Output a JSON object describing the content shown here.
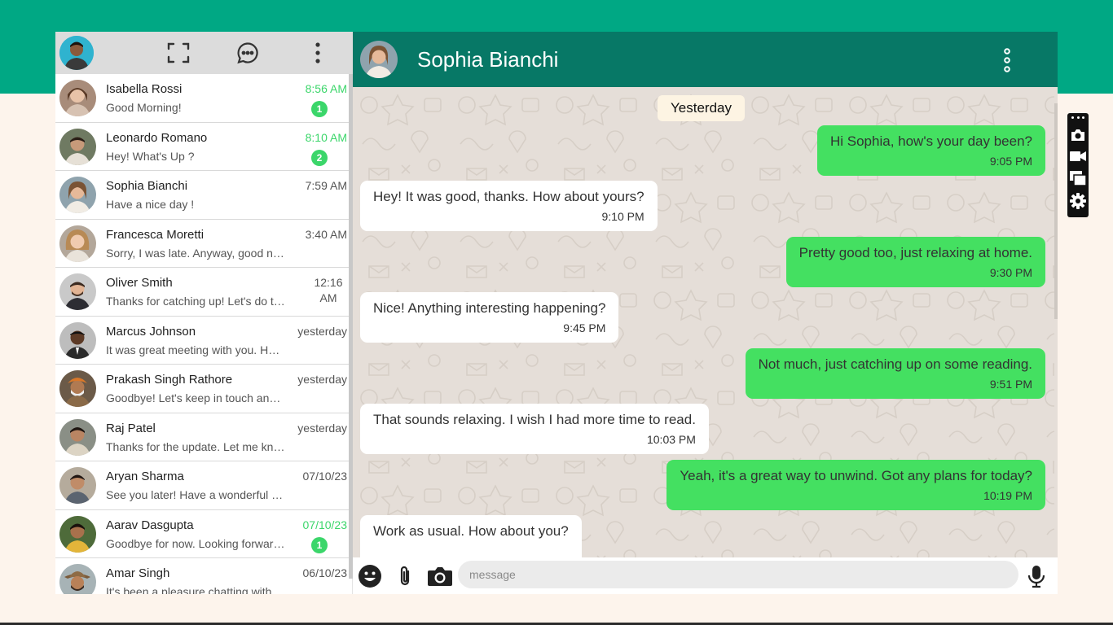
{
  "sidebar": {
    "chats": [
      {
        "name": "Isabella Rossi",
        "message": "Good Morning!",
        "time": "8:56 AM",
        "unread": "1"
      },
      {
        "name": "Leonardo Romano",
        "message": "Hey! What's Up ?",
        "time": "8:10 AM",
        "unread": "2"
      },
      {
        "name": "Sophia Bianchi",
        "message": "Have a nice day !",
        "time": "7:59 AM"
      },
      {
        "name": "Francesca Moretti",
        "message": "Sorry, I was late. Anyway, good night!",
        "time": "3:40 AM"
      },
      {
        "name": "Oliver Smith",
        "message": "Thanks for catching up! Let's do this again soon",
        "time": "12:16 AM"
      },
      {
        "name": "Marcus Johnson",
        "message": "It was great meeting with you. Have a good one",
        "time": "yesterday"
      },
      {
        "name": "Prakash Singh Rathore",
        "message": "Goodbye! Let's keep in touch and talk soon",
        "time": "yesterday"
      },
      {
        "name": "Raj Patel",
        "message": "Thanks for the update. Let me know if anything",
        "time": "yesterday"
      },
      {
        "name": "Aryan Sharma",
        "message": "See you later! Have a wonderful day",
        "time": "07/10/23"
      },
      {
        "name": "Aarav Dasgupta",
        "message": "Goodbye for now. Looking forward to it",
        "time": "07/10/23",
        "unread": "1"
      },
      {
        "name": "Amar Singh",
        "message": "It's been a pleasure chatting with you",
        "time": "06/10/23"
      }
    ]
  },
  "chat": {
    "contact_name": "Sophia Bianchi",
    "date_label": "Yesterday",
    "messages": [
      {
        "dir": "out",
        "text": "Hi Sophia, how's your day been?",
        "time": "9:05 PM"
      },
      {
        "dir": "in",
        "text": "Hey! It was good, thanks. How about yours?",
        "time": "9:10 PM"
      },
      {
        "dir": "out",
        "text": "Pretty good too, just relaxing at home.",
        "time": "9:30 PM"
      },
      {
        "dir": "in",
        "text": "Nice! Anything interesting happening?",
        "time": "9:45 PM"
      },
      {
        "dir": "out",
        "text": "Not much, just catching up on some reading.",
        "time": "9:51 PM"
      },
      {
        "dir": "in",
        "text": "That sounds relaxing. I wish I had more time to read.",
        "time": "10:03 PM"
      },
      {
        "dir": "out",
        "text": "Yeah, it's a great way to unwind. Got any plans for today?",
        "time": "10:19 PM"
      },
      {
        "dir": "in",
        "text": "Work as usual. How about you?",
        "time": ""
      }
    ],
    "composer_placeholder": "message"
  },
  "colors": {
    "brand": "#00a884",
    "header": "#077866",
    "outgoing": "#44e061",
    "incoming": "#ffffff",
    "unread": "#3bd66a"
  },
  "icons": [
    "fullscreen-icon",
    "new-chat-icon",
    "menu-dots-icon",
    "emoji-icon",
    "attach-icon",
    "camera-icon",
    "mic-icon",
    "screenshot-icon",
    "video-icon",
    "window-icon",
    "settings-icon"
  ]
}
